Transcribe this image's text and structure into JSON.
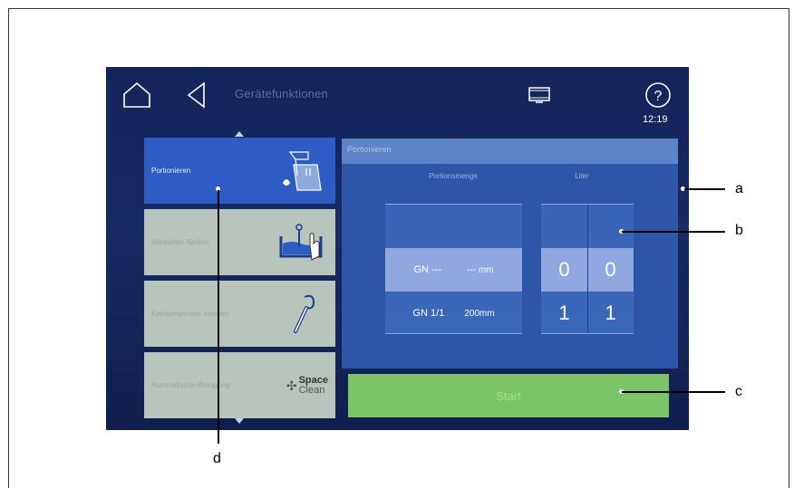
{
  "header": {
    "title": "Gerätefunktionen",
    "time": "12:19",
    "home_icon": "home-icon",
    "back_icon": "back-triangle-icon",
    "display_icon": "display-monitor-icon",
    "help_icon": "help-question-icon",
    "help_glyph": "?"
  },
  "sidebar": {
    "items": [
      {
        "label": "Portionieren",
        "icon": "portioning-bin-icon",
        "selected": true
      },
      {
        "label": "Manuelles Spülen",
        "icon": "manual-rinse-icon",
        "selected": false
      },
      {
        "label": "Kerntemperatur messen",
        "icon": "core-temp-probe-icon",
        "selected": false
      },
      {
        "label": "Automatische Reinigung",
        "icon": "spaceclean-icon",
        "selected": false
      }
    ],
    "spaceclean": {
      "line1": "Space",
      "line2": "Clean"
    }
  },
  "panel": {
    "title": "Portionieren",
    "col_amount": "Portionsmenge",
    "col_liter": "Liter",
    "gn_rows": [
      {
        "size": "GN ---",
        "depth": "--- mm"
      },
      {
        "size": "GN 1/1",
        "depth": "200mm"
      }
    ],
    "liter_rows": [
      {
        "d1": "0",
        "d2": "0"
      },
      {
        "d1": "1",
        "d2": "1"
      }
    ],
    "start_label": "Start"
  },
  "callouts": {
    "a": "a",
    "b": "b",
    "c": "c",
    "d": "d"
  },
  "colors": {
    "screen_bg": "#13245a",
    "selected_item": "#2c5cc4",
    "panel": "#2f55a9",
    "start": "#7bc467"
  }
}
